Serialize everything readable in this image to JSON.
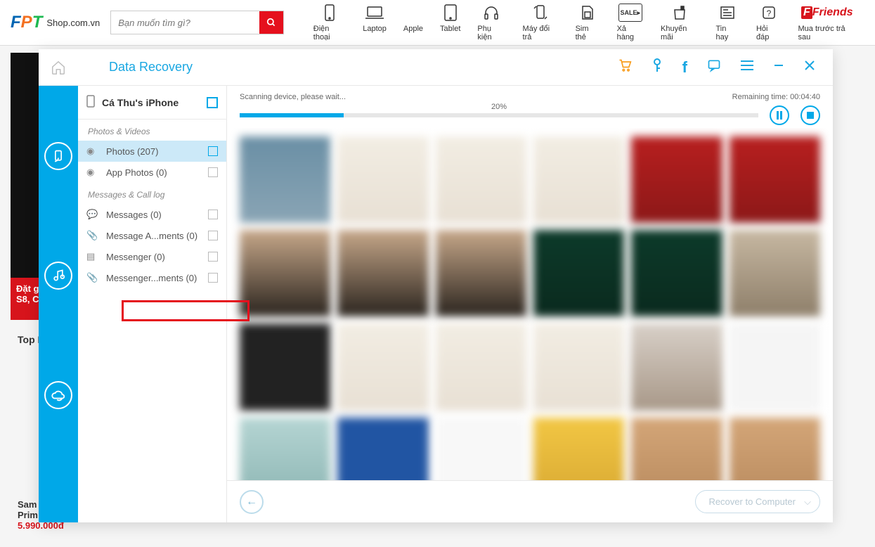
{
  "header": {
    "logo_sub": "Shop.com.vn",
    "search_placeholder": "Bạn muốn tìm gì?",
    "nav": [
      {
        "label": "Điện thoại",
        "icon": "📱"
      },
      {
        "label": "Laptop",
        "icon": "💻"
      },
      {
        "label": "Apple",
        "icon": ""
      },
      {
        "label": "Tablet",
        "icon": "▭"
      },
      {
        "label": "Phụ kiện",
        "icon": "🎧"
      },
      {
        "label": "Máy đổi trả",
        "icon": "↺"
      },
      {
        "label": "Sim thẻ",
        "icon": "▤"
      },
      {
        "label": "Xả hàng",
        "icon": "SALE"
      },
      {
        "label": "Khuyến mãi",
        "icon": "🛍"
      },
      {
        "label": "Tin hay",
        "icon": "📰"
      },
      {
        "label": "Hỏi đáp",
        "icon": "?"
      },
      {
        "label": "Mua trước trả sau",
        "icon": "Friends"
      }
    ]
  },
  "bg": {
    "red_text1": "Đặt g",
    "red_text2": "S8, C",
    "toprank": "Top B",
    "product_name": "Sam",
    "product_sub": "Prim",
    "product_price": "5.990.000đ"
  },
  "app": {
    "title": "Data Recovery",
    "device": "Cá Thu's iPhone",
    "groups": [
      {
        "title": "Photos & Videos",
        "items": [
          {
            "label": "Photos (207)",
            "icon": "◉",
            "active": true
          },
          {
            "label": "App Photos (0)",
            "icon": "◉"
          }
        ]
      },
      {
        "title": "Messages & Call log",
        "items": [
          {
            "label": "Messages (0)",
            "icon": "💬"
          },
          {
            "label": "Message A...ments (0)",
            "icon": "📎"
          },
          {
            "label": "Messenger (0)",
            "icon": "▤"
          },
          {
            "label": "Messenger...ments (0)",
            "icon": "📎"
          }
        ]
      }
    ],
    "progress": {
      "status": "Scanning device, please wait...",
      "remaining": "Remaining time: 00:04:40",
      "percent": "20%",
      "percent_val": 20
    },
    "footer": {
      "recover_label": "Recover to Computer"
    }
  }
}
